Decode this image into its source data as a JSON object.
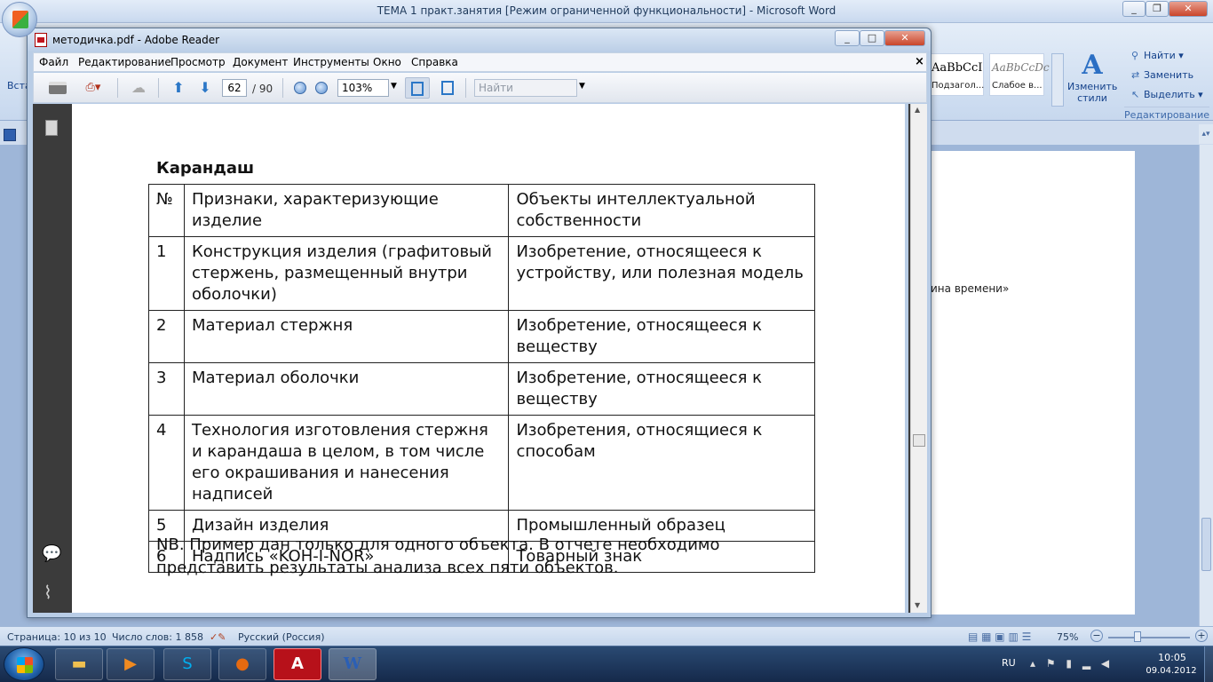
{
  "word": {
    "title": "ТЕМА 1 практ.занятия [Режим ограниченной функциональности] - Microsoft Word",
    "ribbon": {
      "insert_label": "Вста",
      "styles": [
        {
          "sample": "AaBbCcI",
          "name": "Подзагол..."
        },
        {
          "sample": "AaBbCcDc",
          "name": "Слабое в..."
        }
      ],
      "change_styles_label": "Изменить стили",
      "editing": {
        "find": "Найти",
        "replace": "Заменить",
        "select": "Выделить",
        "group_label": "Редактирование"
      }
    },
    "page_text": "ина времени»",
    "statusbar": {
      "page": "Страница: 10 из 10",
      "words": "Число слов: 1 858",
      "language": "Русский (Россия)",
      "zoom": "75%"
    }
  },
  "reader": {
    "title": "методичка.pdf - Adobe Reader",
    "menu": [
      "Файл",
      "Редактирование",
      "Просмотр",
      "Документ",
      "Инструменты",
      "Окно",
      "Справка"
    ],
    "toolbar": {
      "current_page": "62",
      "page_total": "/ 90",
      "zoom": "103%",
      "find_placeholder": "Найти"
    },
    "document": {
      "heading": "Карандаш",
      "table": {
        "header": [
          "№",
          "Признаки, характеризующие изделие",
          "Объекты интеллектуальной собственности"
        ],
        "rows": [
          [
            "1",
            "Конструкция изделия (графитовый стержень, размещенный внутри оболочки)",
            "Изобретение, относящееся к устройству, или полезная модель"
          ],
          [
            "2",
            "Материал стержня",
            "Изобретение, относящееся к веществу"
          ],
          [
            "3",
            "Материал оболочки",
            "Изобретение, относящееся к веществу"
          ],
          [
            "4",
            "Технология изготовления стержня и карандаша в целом, в том числе его окрашивания и нанесения надписей",
            "Изобретения, относящиеся к способам"
          ],
          [
            "5",
            "Дизайн изделия",
            "Промышленный образец"
          ],
          [
            "6",
            "Надпись «KOH-I-NOR»",
            "Товарный знак"
          ]
        ]
      },
      "note": "NB. Пример дан только для одного объекта. В отчете необходимо представить результаты анализа всех пяти объектов."
    }
  },
  "taskbar": {
    "language": "RU",
    "time": "10:05",
    "date": "09.04.2012"
  }
}
